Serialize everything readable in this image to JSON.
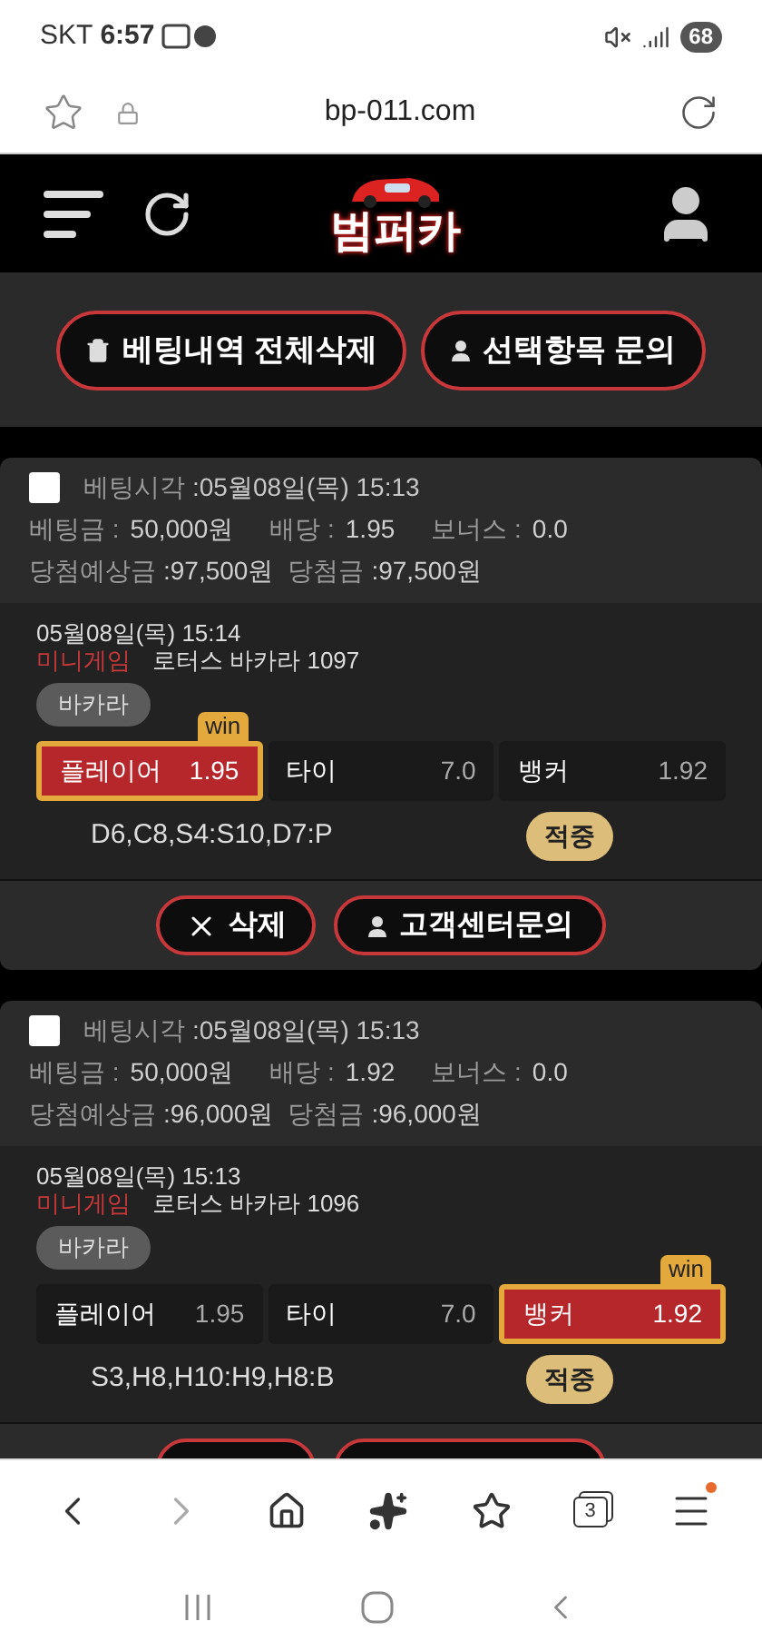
{
  "status_bar": {
    "carrier": "SKT",
    "time": "6:57",
    "battery": "68"
  },
  "browser": {
    "url": "bp-011.com",
    "tab_count": "3",
    "menu_notification": true
  },
  "header": {
    "logo": "범퍼카"
  },
  "toolbar": {
    "buttons": [
      "베팅내역 전체삭제",
      "선택항목 문의"
    ]
  },
  "bets": [
    {
      "checked": false,
      "time_label": "베팅시각",
      "time": ":05월08일(목) 15:13",
      "stake_label": "베팅금 :",
      "stake": "50,000원",
      "odds_label": "배당 :",
      "odds": "1.95",
      "bonus_label": "보너스 :",
      "bonus": "0.0",
      "expected_label": "당첨예상금",
      "expected": ":97,500원",
      "payout_label": "당첨금",
      "payout": ":97,500원",
      "detail": {
        "datetime": "05월08일(목) 15:14",
        "category": "미니게임",
        "game": "로터스 바카라 1097",
        "tag": "바카라",
        "options": [
          {
            "label": "플레이어",
            "odds": "1.95",
            "selected": true,
            "badge": "win"
          },
          {
            "label": "타이",
            "odds": "7.0",
            "selected": false
          },
          {
            "label": "뱅커",
            "odds": "1.92",
            "selected": false
          }
        ],
        "result": "D6,C8,S4:S10,D7:P",
        "status": "적중"
      },
      "actions": [
        "삭제",
        "고객센터문의"
      ]
    },
    {
      "checked": false,
      "time_label": "베팅시각",
      "time": ":05월08일(목) 15:13",
      "stake_label": "베팅금 :",
      "stake": "50,000원",
      "odds_label": "배당 :",
      "odds": "1.92",
      "bonus_label": "보너스 :",
      "bonus": "0.0",
      "expected_label": "당첨예상금",
      "expected": ":96,000원",
      "payout_label": "당첨금",
      "payout": ":96,000원",
      "detail": {
        "datetime": "05월08일(목) 15:13",
        "category": "미니게임",
        "game": "로터스 바카라 1096",
        "tag": "바카라",
        "options": [
          {
            "label": "플레이어",
            "odds": "1.95",
            "selected": false
          },
          {
            "label": "타이",
            "odds": "7.0",
            "selected": false
          },
          {
            "label": "뱅커",
            "odds": "1.92",
            "selected": true,
            "badge": "win"
          }
        ],
        "result": "S3,H8,H10:H9,H8:B",
        "status": "적중"
      }
    }
  ]
}
